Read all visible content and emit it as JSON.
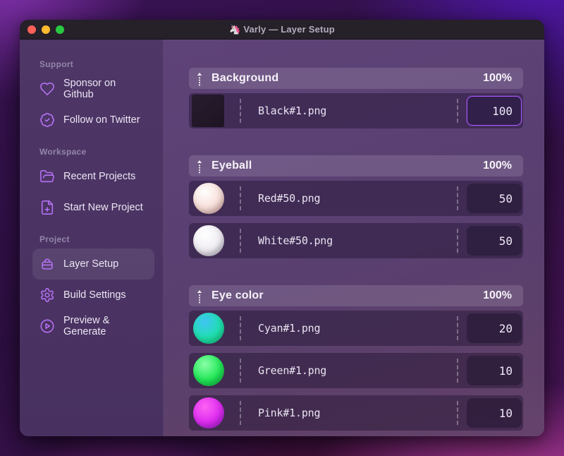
{
  "window": {
    "app_icon": "🦄",
    "title": "Varly — Layer Setup",
    "traffic_lights": {
      "close": "#ff5f57",
      "minimize": "#febc2e",
      "zoom": "#28c840"
    }
  },
  "sidebar": {
    "accent_color": "#b672f5",
    "sections": [
      {
        "label": "Support",
        "items": [
          {
            "label": "Sponsor on Github",
            "icon": "heart-icon"
          },
          {
            "label": "Follow on Twitter",
            "icon": "badge-check-icon"
          }
        ]
      },
      {
        "label": "Workspace",
        "items": [
          {
            "label": "Recent Projects",
            "icon": "folder-open-icon"
          },
          {
            "label": "Start New Project",
            "icon": "file-plus-icon"
          }
        ]
      },
      {
        "label": "Project",
        "items": [
          {
            "label": "Layer Setup",
            "icon": "layer-bag-icon",
            "active": true
          },
          {
            "label": "Build Settings",
            "icon": "gear-icon"
          },
          {
            "label": "Preview & Generate",
            "icon": "play-circle-icon"
          }
        ]
      }
    ]
  },
  "main": {
    "groups": [
      {
        "title": "Background",
        "weight": "100%",
        "layers": [
          {
            "file": "Black#1.png",
            "value": "100",
            "focused": true,
            "thumb": {
              "shape": "square",
              "colors": [
                "#271c2e",
                "#1d1423"
              ]
            }
          }
        ]
      },
      {
        "title": "Eyeball",
        "weight": "100%",
        "layers": [
          {
            "file": "Red#50.png",
            "value": "50",
            "focused": false,
            "thumb": {
              "shape": "circle",
              "colors": [
                "#ffffff",
                "#f7ded9",
                "#d5a09b"
              ]
            }
          },
          {
            "file": "White#50.png",
            "value": "50",
            "focused": false,
            "thumb": {
              "shape": "circle",
              "colors": [
                "#ffffff",
                "#efecf2",
                "#b5adc0"
              ]
            }
          }
        ]
      },
      {
        "title": "Eye color",
        "weight": "100%",
        "layers": [
          {
            "file": "Cyan#1.png",
            "value": "20",
            "focused": false,
            "thumb": {
              "shape": "circle",
              "colors": [
                "#41c4f6",
                "#1fe0ae",
                "#13d17c"
              ]
            }
          },
          {
            "file": "Green#1.png",
            "value": "10",
            "focused": false,
            "thumb": {
              "shape": "circle",
              "colors": [
                "#8affa8",
                "#22e757",
                "#0cb843"
              ]
            }
          },
          {
            "file": "Pink#1.png",
            "value": "10",
            "focused": false,
            "thumb": {
              "shape": "circle",
              "colors": [
                "#fd62f3",
                "#dd2cf0",
                "#9d1ad4"
              ]
            }
          }
        ]
      }
    ]
  }
}
